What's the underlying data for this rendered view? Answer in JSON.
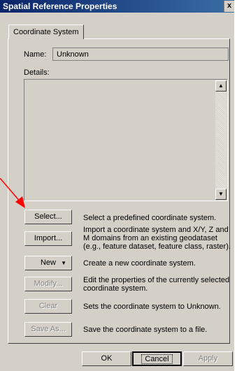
{
  "window": {
    "title": "Spatial Reference Properties",
    "close_glyph": "x"
  },
  "tab": {
    "label": "Coordinate System"
  },
  "name": {
    "label": "Name:",
    "value": "Unknown"
  },
  "details": {
    "label": "Details:"
  },
  "actions": [
    {
      "label": "Select...",
      "description": "Select a predefined coordinate system.",
      "enabled": true
    },
    {
      "label": "Import...",
      "description": "Import a coordinate system and X/Y, Z and M domains from an existing geodataset (e.g., feature dataset, feature class, raster).",
      "enabled": true
    },
    {
      "label": "New",
      "description": "Create a new coordinate system.",
      "enabled": true
    },
    {
      "label": "Modify...",
      "description": "Edit the properties of the currently selected coordinate system.",
      "enabled": false
    },
    {
      "label": "Clear",
      "description": "Sets the coordinate system to Unknown.",
      "enabled": false
    },
    {
      "label": "Save As...",
      "description": "Save the coordinate system to a file.",
      "enabled": false
    }
  ],
  "footer": {
    "ok": "OK",
    "cancel": "Cancel",
    "apply": "Apply"
  },
  "colors": {
    "arrow": "#ff0000",
    "titlebar_start": "#0a246a",
    "titlebar_end": "#3a6ea5",
    "dialog_bg": "#d4d0c8"
  }
}
